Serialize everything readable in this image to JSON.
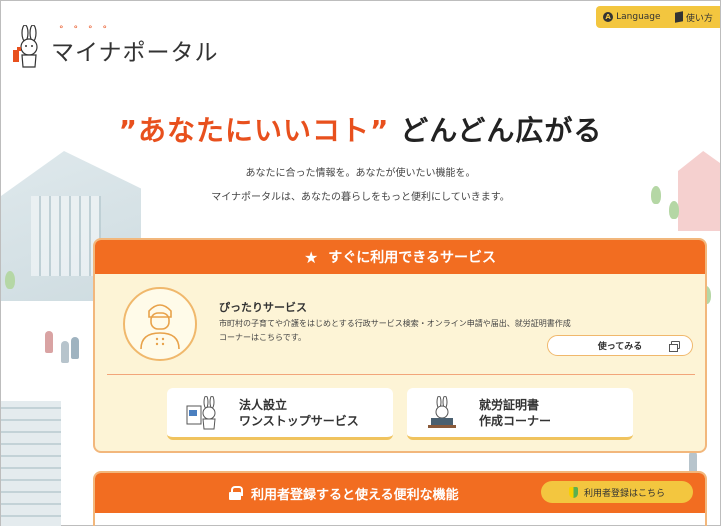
{
  "header": {
    "logo_text": "マイナポータル",
    "language_label": "Language",
    "guide_label": "使い方"
  },
  "hero": {
    "headline_accent": "”あなたにいいコト”",
    "headline_rest": "どんどん広がる",
    "subtitle_1": "あなたに合った情報を。あなたが使いたい機能を。",
    "subtitle_2": "マイナポータルは、あなたの暮らしをもっと便利にしていきます。"
  },
  "services_panel": {
    "title": "すぐに利用できるサービス",
    "pittari": {
      "title": "ぴったりサービス",
      "description": "市町村の子育てや介護をはじめとする行政サービス検索・オンライン申請や届出、就労証明書作成コーナーはこちらです。",
      "button_label": "使ってみる"
    },
    "sub_buttons": [
      {
        "label": "法人設立\nワンストップサービス"
      },
      {
        "label": "就労証明書\n作成コーナー"
      }
    ]
  },
  "registered_panel": {
    "title": "利用者登録すると使える便利な機能",
    "register_button": "利用者登録はこちら"
  },
  "colors": {
    "accent_orange": "#f26d21",
    "headline_orange": "#e8501d",
    "yellow": "#f3c63f",
    "panel_bg": "#fdf4d6"
  }
}
